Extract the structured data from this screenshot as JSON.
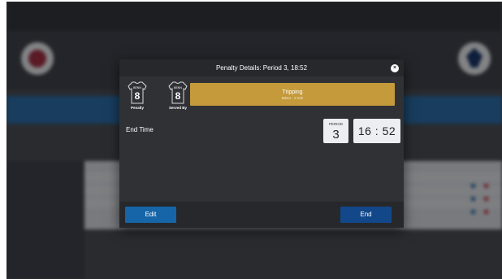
{
  "modal": {
    "title": "Penalty Details: Period 3, 18:52",
    "close_glyph": "×",
    "penalty_player": {
      "name": "BENN",
      "number": "8",
      "caption": "Penalty"
    },
    "served_by_player": {
      "name": "BENN",
      "number": "8",
      "caption": "Served By"
    },
    "penalty_type": "Tripping",
    "penalty_subtitle": "Minor - 2 min",
    "end_time_label": "End Time",
    "period_label": "PERIOD",
    "period_value": "3",
    "time_value": "16 : 52",
    "edit_label": "Edit",
    "end_label": "End"
  },
  "colors": {
    "accent_blue": "#1565a8",
    "end_button": "#12478a",
    "penalty_gold": "#c49a3b",
    "modal_bg": "#2f3135",
    "home_red": "#a6192e",
    "away_blue": "#00205b"
  },
  "icons": [
    "jersey-icon",
    "close-icon",
    "team-logo-home",
    "team-logo-away"
  ]
}
